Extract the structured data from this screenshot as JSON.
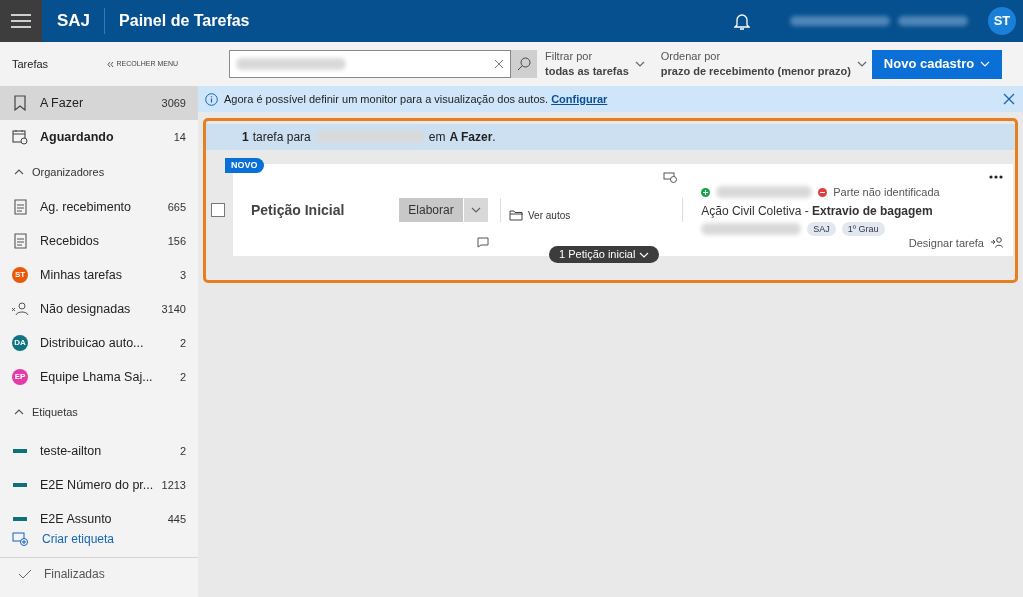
{
  "header": {
    "logo": "SAJ",
    "title": "Painel de Tarefas",
    "avatar": "ST"
  },
  "sidebar": {
    "title": "Tarefas",
    "collapse": "RECOLHER MENU",
    "top_items": [
      {
        "kind": "bookmark",
        "label": "A Fazer",
        "count": "3069",
        "selected": true,
        "bold": false
      },
      {
        "kind": "calendar",
        "label": "Aguardando",
        "count": "14",
        "selected": false,
        "bold": true
      }
    ],
    "sections": [
      {
        "title": "Organizadores",
        "expanded": true,
        "items": [
          {
            "kind": "document",
            "label": "Ag. recebimento",
            "count": "665"
          },
          {
            "kind": "document",
            "label": "Recebidos",
            "count": "156"
          },
          {
            "kind": "avatar",
            "initials": "ST",
            "color": "#e8590c",
            "label": "Minhas tarefas",
            "count": "3"
          },
          {
            "kind": "unassigned",
            "label": "Não designadas",
            "count": "3140"
          },
          {
            "kind": "avatar",
            "initials": "DA",
            "color": "#0f7583",
            "label": "Distribuicao auto...",
            "count": "2"
          },
          {
            "kind": "avatar",
            "initials": "EP",
            "color": "#e43ba6",
            "label": "Equipe Lhama Saj...",
            "count": "2"
          }
        ]
      },
      {
        "title": "Etiquetas",
        "expanded": true,
        "items": [
          {
            "kind": "tag",
            "color": "#0f6f7a",
            "label": "teste-ailton",
            "count": "2"
          },
          {
            "kind": "tag",
            "color": "#0f6f7a",
            "label": "E2E Número do pr...",
            "count": "1213"
          },
          {
            "kind": "tag",
            "color": "#0f6f7a",
            "label": "E2E Assunto",
            "count": "445"
          }
        ]
      }
    ],
    "create_label": "Criar etiqueta",
    "footer": "Finalizadas"
  },
  "toolbar": {
    "filter_label": "Filtrar por",
    "filter_value": "todas as tarefas",
    "sort_label": "Ordenar por",
    "sort_value": "prazo de recebimento (menor prazo)",
    "new_button": "Novo cadastro"
  },
  "info_bar": {
    "text": "Agora é possível definir um monitor para a visualização dos autos.",
    "link": "Configurar"
  },
  "summary": {
    "count": "1",
    "before": "tarefa para",
    "after": "em",
    "target": "A Fazer",
    "end": "."
  },
  "task": {
    "badge": "NOVO",
    "checked": false,
    "title": "Petição Inicial",
    "action": "Elaborar",
    "view": "Ver autos",
    "party_status": "Parte não identificada",
    "case_class": "Ação Civil Coletiva",
    "separator": "-",
    "subject": "Extravio de bagagem",
    "tags": [
      "SAJ",
      "1º Grau"
    ],
    "assign": "Designar tarefa",
    "documents": "1 Petição inicial"
  }
}
